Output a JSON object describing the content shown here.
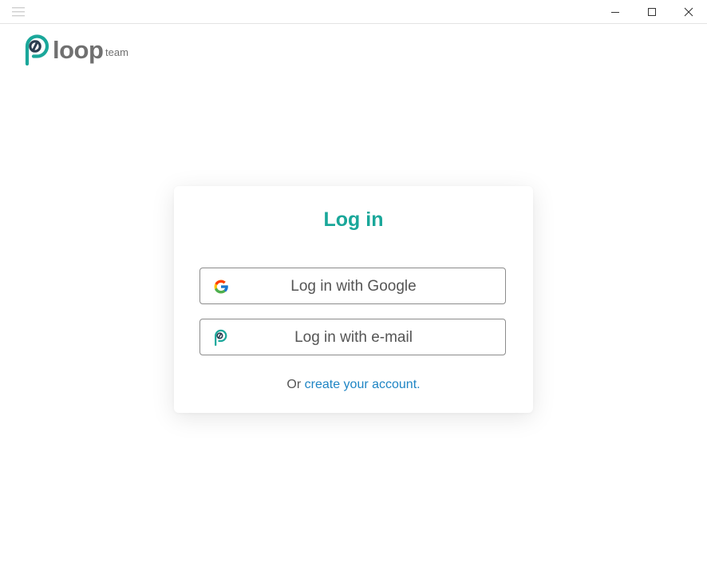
{
  "window": {
    "menu_icon": "hamburger-icon",
    "controls": [
      "minimize-icon",
      "maximize-icon",
      "close-icon"
    ]
  },
  "brand": {
    "name": "loop",
    "sub": "team",
    "mark_icon": "loop-logo-icon"
  },
  "login": {
    "title": "Log in",
    "google_label": "Log in with Google",
    "email_label": "Log in with e-mail",
    "footer_prefix": "Or",
    "create_link": "create your account."
  },
  "colors": {
    "accent": "#1aa79a",
    "link": "#1f85c4",
    "text": "#555555",
    "brand_text": "#707070"
  }
}
